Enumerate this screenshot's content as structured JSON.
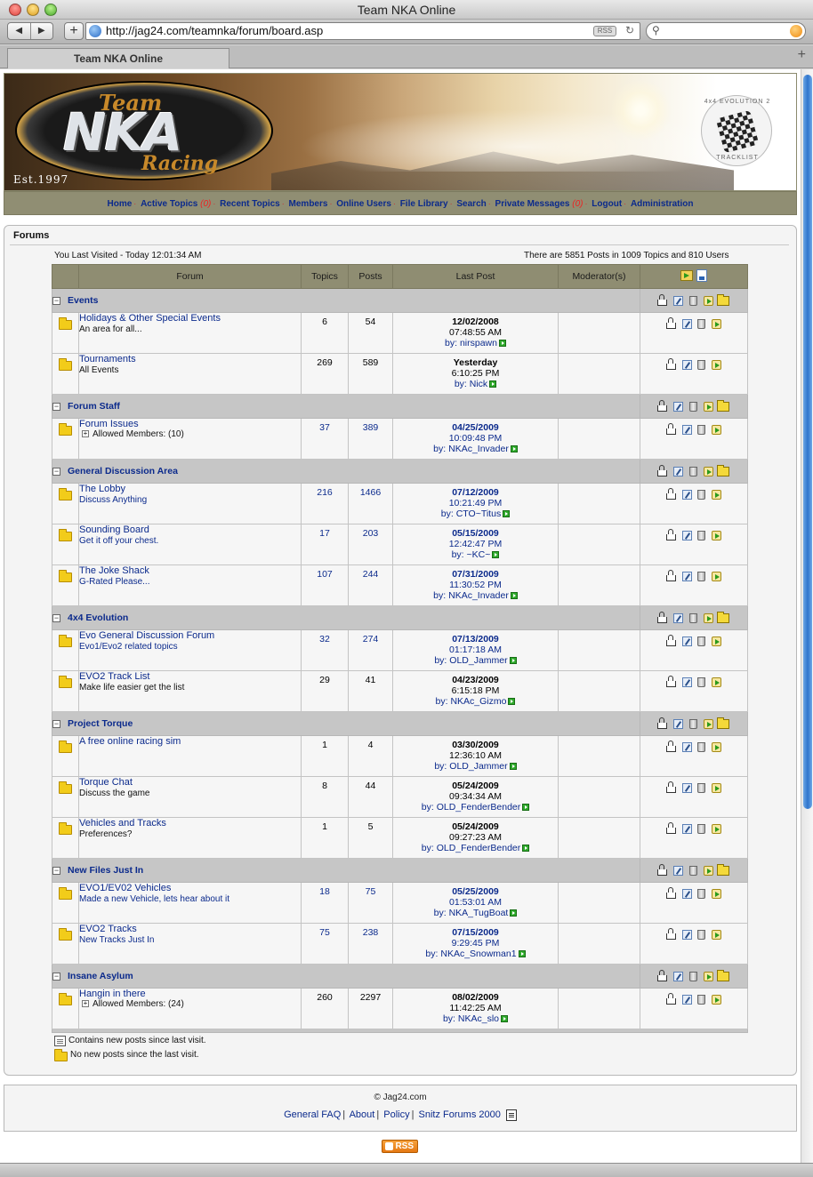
{
  "window": {
    "title": "Team NKA Online"
  },
  "browser": {
    "url": "http://jag24.com/teamnka/forum/board.asp",
    "tab_title": "Team NKA Online",
    "rss_badge": "RSS",
    "search_placeholder": ""
  },
  "banner": {
    "logo_team": "Team",
    "logo_nka": "NKA",
    "logo_racing": "Racing",
    "logo_est": "Est.1997",
    "badge_top": "4x4 EVOLUTION 2",
    "badge_bottom": "TRACKLIST"
  },
  "nav": {
    "items": [
      {
        "label": "Home"
      },
      {
        "label": "Active Topics",
        "count": "(0)"
      },
      {
        "label": "Recent Topics"
      },
      {
        "label": "Members"
      },
      {
        "label": "Online Users"
      },
      {
        "label": "File Library"
      },
      {
        "label": "Search"
      },
      {
        "label": "Private Messages",
        "count": "(0)"
      },
      {
        "label": "Logout"
      },
      {
        "label": "Administration"
      }
    ]
  },
  "forums_box": {
    "title": "Forums",
    "last_visited": "You Last Visited - Today 12:01:34 AM",
    "stats": "There are 5851 Posts in 1009 Topics and 810 Users"
  },
  "table": {
    "headers": {
      "forum": "Forum",
      "topics": "Topics",
      "posts": "Posts",
      "last_post": "Last Post",
      "moderators": "Moderator(s)"
    },
    "categories": [
      {
        "name": "Events",
        "forums": [
          {
            "name": "Holidays & Other Special Events",
            "desc": "An area for all...",
            "topics": "6",
            "posts": "54",
            "date": "12/02/2008",
            "time": "07:48:55 AM",
            "by": "nirspawn",
            "blue": false
          },
          {
            "name": "Tournaments",
            "desc": "All Events",
            "topics": "269",
            "posts": "589",
            "date": "Yesterday",
            "time": "6:10:25 PM",
            "by": "Nick",
            "blue": false
          }
        ]
      },
      {
        "name": "Forum Staff",
        "forums": [
          {
            "name": "Forum Issues",
            "allowed": "Allowed Members: (10)",
            "topics": "37",
            "posts": "389",
            "date": "04/25/2009",
            "time": "10:09:48 PM",
            "by": "NKAc_Invader",
            "blue": true
          }
        ]
      },
      {
        "name": "General Discussion Area",
        "forums": [
          {
            "name": "The Lobby",
            "desc": "Discuss Anything",
            "topics": "216",
            "posts": "1466",
            "date": "07/12/2009",
            "time": "10:21:49 PM",
            "by": "CTO~Titus",
            "blue": true
          },
          {
            "name": "Sounding Board",
            "desc": "Get it off your chest.",
            "topics": "17",
            "posts": "203",
            "date": "05/15/2009",
            "time": "12:42:47 PM",
            "by": "~KC~",
            "blue": true
          },
          {
            "name": "The Joke Shack",
            "desc": "G-Rated Please...",
            "topics": "107",
            "posts": "244",
            "date": "07/31/2009",
            "time": "11:30:52 PM",
            "by": "NKAc_Invader",
            "blue": true
          }
        ]
      },
      {
        "name": "4x4 Evolution",
        "forums": [
          {
            "name": "Evo General Discussion Forum",
            "desc": "Evo1/Evo2 related topics",
            "topics": "32",
            "posts": "274",
            "date": "07/13/2009",
            "time": "01:17:18 AM",
            "by": "OLD_Jammer",
            "blue": true
          },
          {
            "name": "EVO2 Track List",
            "desc": "Make life easier get the list",
            "topics": "29",
            "posts": "41",
            "date": "04/23/2009",
            "time": "6:15:18 PM",
            "by": "NKAc_Gizmo",
            "blue": false
          }
        ]
      },
      {
        "name": "Project Torque",
        "forums": [
          {
            "name": "A free online racing sim",
            "desc": "",
            "topics": "1",
            "posts": "4",
            "date": "03/30/2009",
            "time": "12:36:10 AM",
            "by": "OLD_Jammer",
            "blue": false
          },
          {
            "name": "Torque Chat",
            "desc": "Discuss the game",
            "topics": "8",
            "posts": "44",
            "date": "05/24/2009",
            "time": "09:34:34 AM",
            "by": "OLD_FenderBender",
            "blue": false
          },
          {
            "name": "Vehicles and Tracks",
            "desc": "Preferences?",
            "topics": "1",
            "posts": "5",
            "date": "05/24/2009",
            "time": "09:27:23 AM",
            "by": "OLD_FenderBender",
            "blue": false
          }
        ]
      },
      {
        "name": "New Files Just In",
        "forums": [
          {
            "name": "EVO1/EV02 Vehicles",
            "desc": "Made a new Vehicle, lets hear about it",
            "topics": "18",
            "posts": "75",
            "date": "05/25/2009",
            "time": "01:53:01 AM",
            "by": "NKA_TugBoat",
            "blue": true
          },
          {
            "name": "EVO2 Tracks",
            "desc": "New Tracks Just In",
            "topics": "75",
            "posts": "238",
            "date": "07/15/2009",
            "time": "9:29:45 PM",
            "by": "NKAc_Snowman1",
            "blue": true
          }
        ]
      },
      {
        "name": "Insane Asylum",
        "forums": [
          {
            "name": "Hangin in there",
            "allowed": "Allowed Members: (24)",
            "topics": "260",
            "posts": "2297",
            "date": "08/02/2009",
            "time": "11:42:25 AM",
            "by": "NKAc_slo",
            "blue": false
          }
        ]
      }
    ],
    "by_label": "by:"
  },
  "legend": {
    "new_posts": "Contains new posts since last visit.",
    "no_new_posts": "No new posts since the last visit."
  },
  "footer": {
    "copyright": "© Jag24.com",
    "links": [
      "General FAQ",
      "About",
      "Policy",
      "Snitz Forums 2000"
    ],
    "rss": "RSS"
  },
  "colors": {
    "nav_bg": "#908e73",
    "category_bg": "#c6c6c6",
    "link": "#0b2a8c",
    "accent_count": "#e22"
  }
}
